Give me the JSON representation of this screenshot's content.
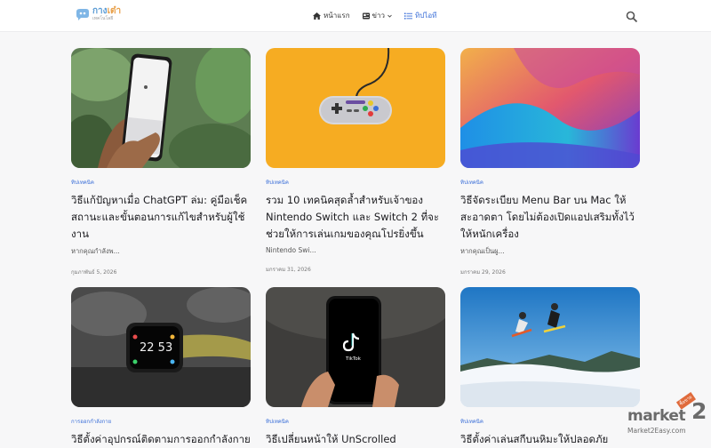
{
  "header": {
    "logo_main_a": "กาง",
    "logo_main_b": "เต๋า",
    "logo_sub": "เทคโนโลยี",
    "nav": [
      {
        "label": "หน้าแรก",
        "icon": "home-icon"
      },
      {
        "label": "ข่าว",
        "icon": "news-icon"
      },
      {
        "label": "ทิปไอที",
        "icon": "list-icon",
        "active": true
      }
    ],
    "accent": "#3b6fd8"
  },
  "cards": [
    {
      "category": "ทิปเทคนิค",
      "title": "วิธีแก้ปัญหาเมื่อ ChatGPT ล่ม: คู่มือเช็คสถานะและขั้นตอนการแก้ไขสำหรับผู้ใช้งาน",
      "excerpt": "หากคุณกำลังพ...",
      "date": "กุมภาพันธ์ 5, 2026"
    },
    {
      "category": "ทิปเทคนิค",
      "title": "รวม 10 เทคนิคสุดล้ำสำหรับเจ้าของ Nintendo Switch และ Switch 2 ที่จะช่วยให้การเล่นเกมของคุณโปรยิ่งขึ้น",
      "excerpt": "Nintendo Swi...",
      "date": "มกราคม 31, 2026"
    },
    {
      "category": "ทิปเทคนิค",
      "title": "วิธีจัดระเบียบ Menu Bar บน Mac ให้สะอาดตา โดยไม่ต้องเปิดแอปเสริมทั้งไว้ให้หนักเครื่อง",
      "excerpt": "หากคุณเป็นผู...",
      "date": "มกราคม 29, 2026"
    },
    {
      "category": "การออกกำลังกาย",
      "title": "วิธีตั้งค่าอุปกรณ์ติดตามการออกกำลังกาย",
      "excerpt": "",
      "date": ""
    },
    {
      "category": "ทิปเทคนิค",
      "title": "วิธีเปลี่ยนหน้าให้ UnScrolled",
      "excerpt": "",
      "date": ""
    },
    {
      "category": "ทิปเทคนิค",
      "title": "วิธีตั้งค่าเล่นสกีบนหิมะให้ปลอดภัย",
      "excerpt": "",
      "date": ""
    }
  ],
  "watermark": {
    "brand": "market",
    "two": "2",
    "badge": "ซื้อขาย",
    "url": "Market2Easy.com"
  }
}
